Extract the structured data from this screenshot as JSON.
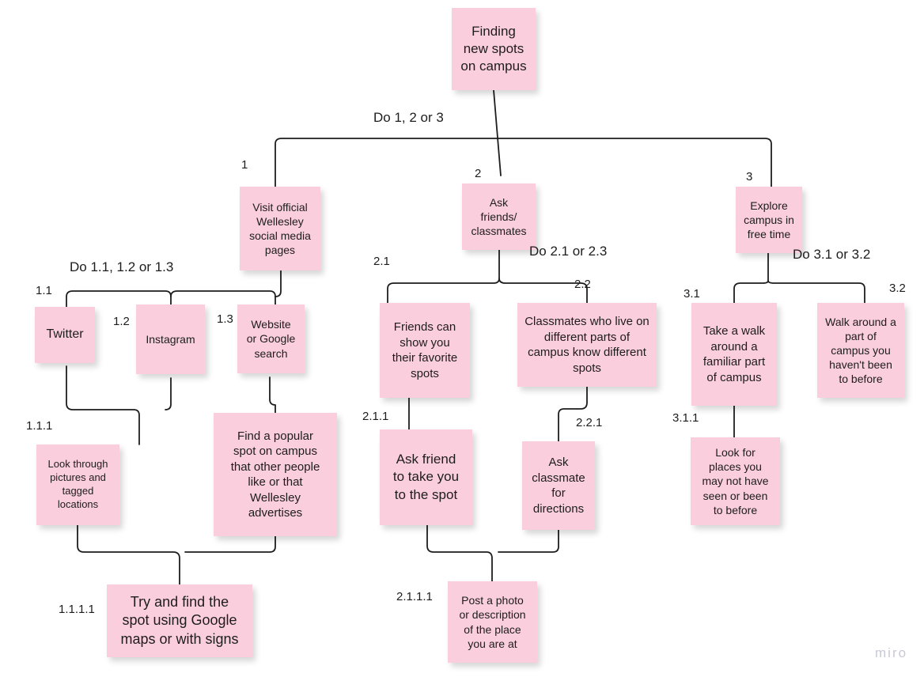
{
  "board": {
    "title": "Finding new spots on campus",
    "watermark": "miro",
    "note_color": "#fbcede",
    "line_color": "#1d1d1d",
    "text_color": "#1d1d1d",
    "background": "#ffffff"
  },
  "nodes": {
    "root": {
      "id": "0",
      "text": "Finding\nnew spots\non campus"
    },
    "n1": {
      "id": "1",
      "text": "Visit official\nWellesley\nsocial media\npages"
    },
    "n2": {
      "id": "2",
      "text": "Ask\nfriends/\nclassmates"
    },
    "n3": {
      "id": "3",
      "text": "Explore\ncampus in\nfree time"
    },
    "n11": {
      "id": "1.1",
      "text": "Twitter"
    },
    "n12": {
      "id": "1.2",
      "text": "Instagram"
    },
    "n13": {
      "id": "1.3",
      "text": "Website\nor Google\nsearch"
    },
    "n111": {
      "id": "1.1.1",
      "text": "Look through\npictures and\ntagged\nlocations"
    },
    "n131": {
      "id": "",
      "text": "Find a popular\nspot on campus\nthat other people\nlike or that\nWellesley\nadvertises"
    },
    "n1111": {
      "id": "1.1.1.1",
      "text": "Try and find the\nspot using Google\nmaps or with signs"
    },
    "n21": {
      "id": "2.1",
      "text": "Friends can\nshow you\ntheir favorite\nspots"
    },
    "n22": {
      "id": "2.2",
      "text": "Classmates who live on\ndifferent parts of\ncampus know different\nspots"
    },
    "n211": {
      "id": "2.1.1",
      "text": "Ask friend\nto take you\nto the spot"
    },
    "n221": {
      "id": "2.2.1",
      "text": "Ask\nclassmate\nfor\ndirections"
    },
    "n2111": {
      "id": "2.1.1.1",
      "text": "Post a photo\nor description\nof the place\nyou are at"
    },
    "n31": {
      "id": "3.1",
      "text": "Take a walk\naround a\nfamiliar part\nof campus"
    },
    "n32": {
      "id": "3.2",
      "text": "Walk around a\npart of\ncampus you\nhaven't been\nto before"
    },
    "n311": {
      "id": "3.1.1",
      "text": "Look for\nplaces you\nmay not have\nseen or been\nto before"
    }
  },
  "plan_labels": {
    "root": "Do 1, 2 or 3",
    "n1": "Do 1.1, 1.2 or 1.3",
    "n2": "Do 2.1 or 2.3",
    "n3": "Do 3.1 or 3.2"
  }
}
